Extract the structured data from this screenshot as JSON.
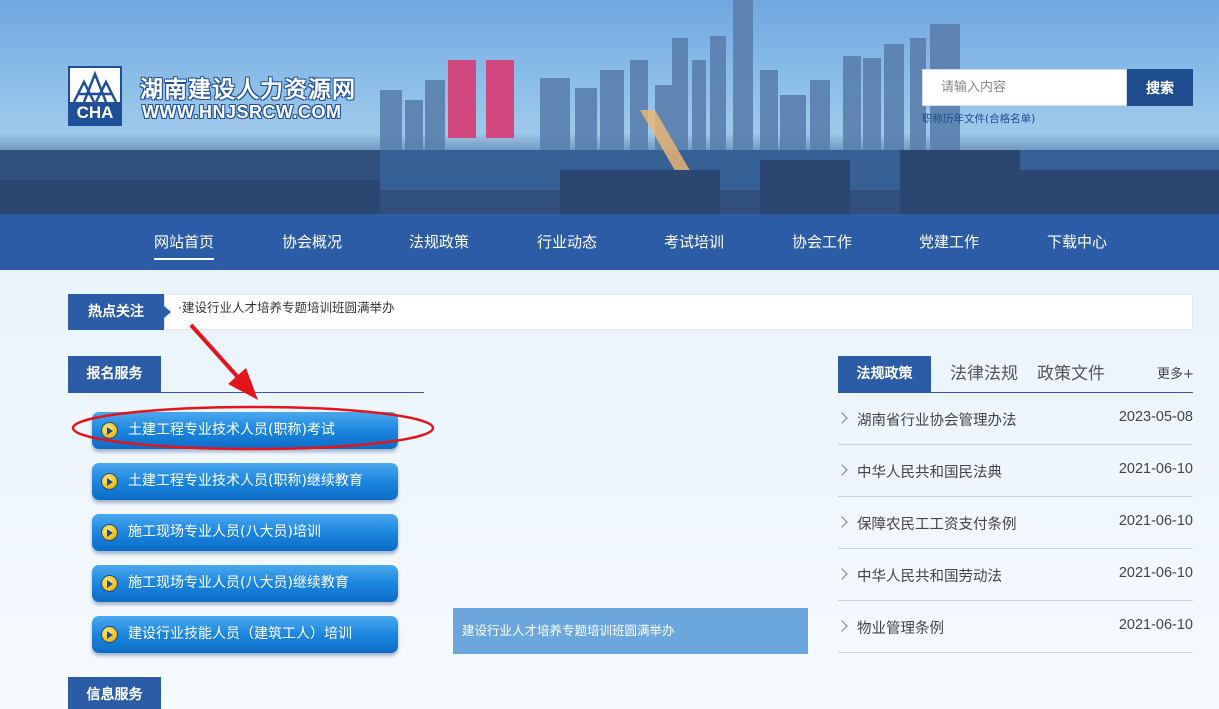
{
  "header": {
    "site_title": "湖南建设人力资源网",
    "site_url": "WWW.HNJSRCW.COM",
    "logo_text": "CHA",
    "search": {
      "placeholder": "请输入内容",
      "value": "",
      "button_label": "搜索",
      "hint": "职称历年文件(合格名单)"
    }
  },
  "nav": {
    "items": [
      {
        "label": "网站首页",
        "active": true
      },
      {
        "label": "协会概况"
      },
      {
        "label": "法规政策"
      },
      {
        "label": "行业动态"
      },
      {
        "label": "考试培训"
      },
      {
        "label": "协会工作"
      },
      {
        "label": "党建工作"
      },
      {
        "label": "下载中心"
      }
    ]
  },
  "hot": {
    "label": "热点关注",
    "text": "·建设行业人才培养专题培训班圆满举办"
  },
  "registration": {
    "title": "报名服务",
    "items": [
      {
        "label": "土建工程专业技术人员(职称)考试"
      },
      {
        "label": "土建工程专业技术人员(职称)继续教育"
      },
      {
        "label": "施工现场专业人员(八大员)培训"
      },
      {
        "label": "施工现场专业人员(八大员)继续教育"
      },
      {
        "label": "建设行业技能人员（建筑工人）培训"
      }
    ]
  },
  "info": {
    "title": "信息服务"
  },
  "news_slide": {
    "caption": "建设行业人才培养专题培训班圆满举办"
  },
  "law": {
    "tab_active": "法规政策",
    "tabs": [
      "法律法规",
      "政策文件"
    ],
    "more": "更多+",
    "items": [
      {
        "title": "湖南省行业协会管理办法",
        "date": "2023-05-08"
      },
      {
        "title": "中华人民共和国民法典",
        "date": "2021-06-10"
      },
      {
        "title": "保障农民工工资支付条例",
        "date": "2021-06-10"
      },
      {
        "title": "中华人民共和国劳动法",
        "date": "2021-06-10"
      },
      {
        "title": "物业管理条例",
        "date": "2021-06-10"
      }
    ]
  },
  "colors": {
    "primary_blue": "#2c5ca6",
    "button_blue": "#1c86de",
    "annotation_red": "#e3141b"
  }
}
